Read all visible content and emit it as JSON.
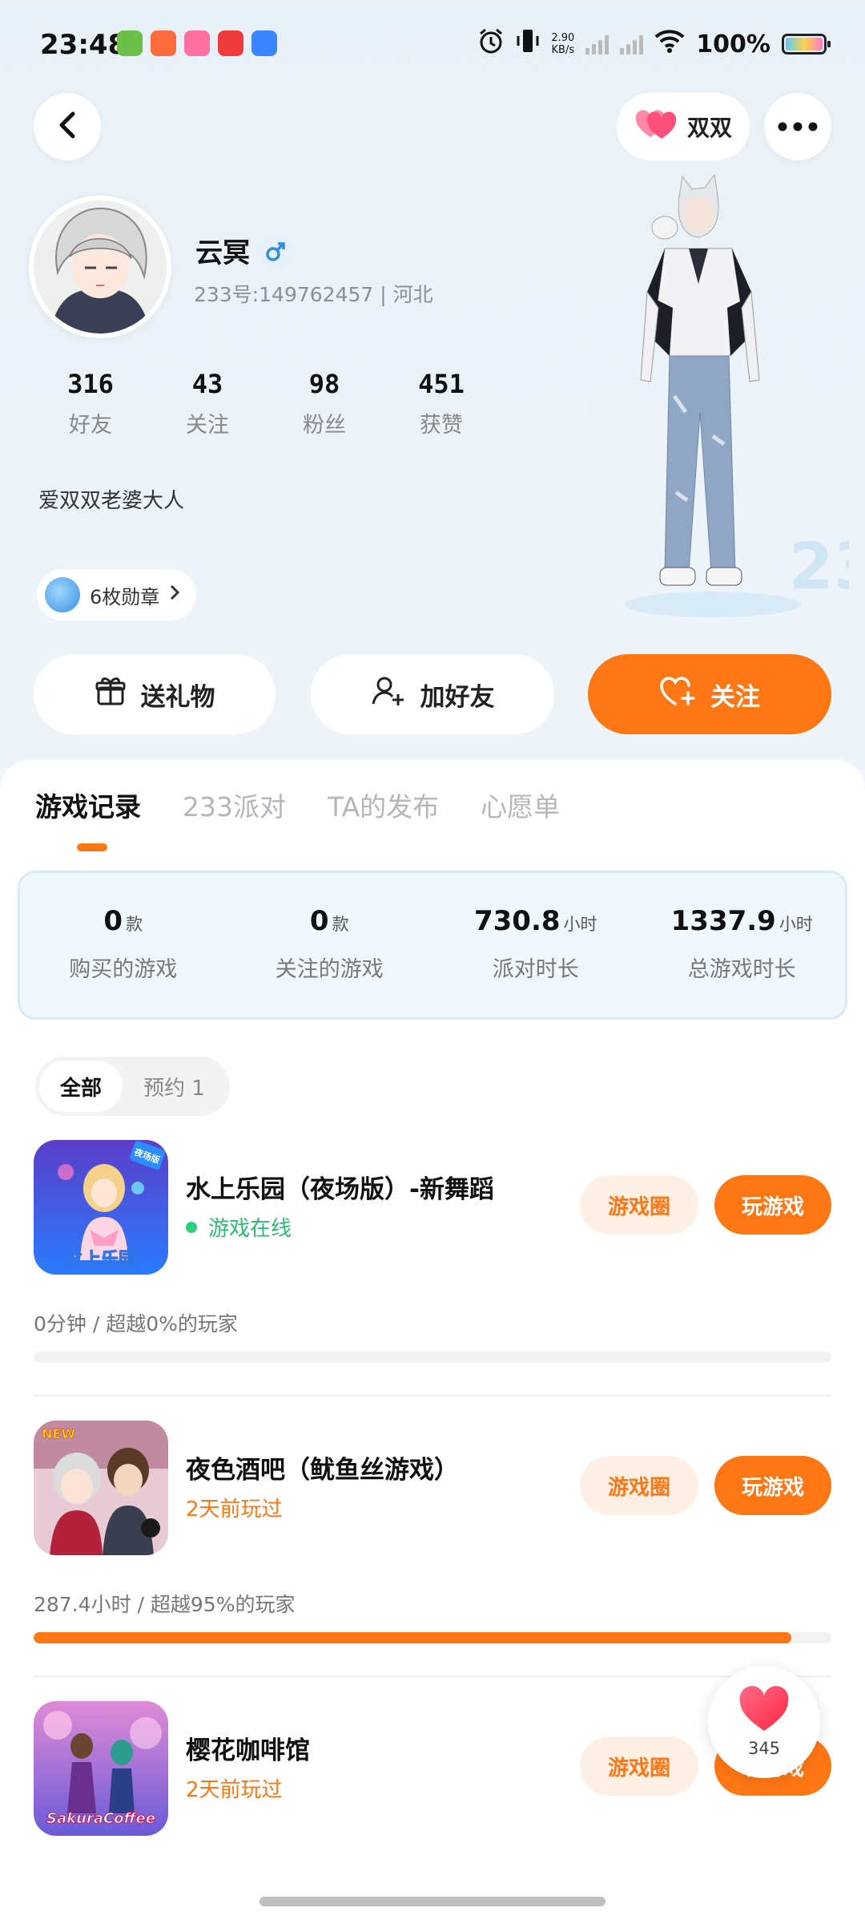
{
  "status_bar": {
    "time": "23:48",
    "speed_top": "2.90",
    "speed_unit": "KB/s",
    "battery": "100%"
  },
  "top_nav": {
    "couple_label": "双双"
  },
  "profile": {
    "name": "云冥",
    "uid_line": "233号:149762457 | 河北",
    "stats": [
      {
        "num": "316",
        "label": "好友"
      },
      {
        "num": "43",
        "label": "关注"
      },
      {
        "num": "98",
        "label": "粉丝"
      },
      {
        "num": "451",
        "label": "获赞"
      }
    ],
    "bio": "爱双双老婆大人",
    "medal_label": "6枚勋章"
  },
  "actions": {
    "gift": "送礼物",
    "add_friend": "加好友",
    "follow": "关注"
  },
  "tabs": [
    "游戏记录",
    "233派对",
    "TA的发布",
    "心愿单"
  ],
  "summary": [
    {
      "value": "0",
      "unit": "款",
      "label": "购买的游戏"
    },
    {
      "value": "0",
      "unit": "款",
      "label": "关注的游戏"
    },
    {
      "value": "730.8",
      "unit": "小时",
      "label": "派对时长"
    },
    {
      "value": "1337.9",
      "unit": "小时",
      "label": "总游戏时长"
    }
  ],
  "filter": {
    "all": "全部",
    "reserved": "预约 1"
  },
  "games": [
    {
      "title": "水上乐园（夜场版）-新舞蹈",
      "status": "游戏在线",
      "online": true,
      "time_line": "0分钟 / 超越0%的玩家",
      "progress": 0,
      "circle_btn": "游戏圈",
      "play_btn": "玩游戏",
      "icon_text": "水上乐园",
      "badge": "夜场版"
    },
    {
      "title": "夜色酒吧（鱿鱼丝游戏）",
      "status": "2天前玩过",
      "online": false,
      "time_line": "287.4小时 / 超越95%的玩家",
      "progress": 0.95,
      "circle_btn": "游戏圈",
      "play_btn": "玩游戏",
      "icon_text": "",
      "badge": "NEW"
    },
    {
      "title": "樱花咖啡馆",
      "status": "2天前玩过",
      "online": false,
      "time_line": "",
      "progress": 0,
      "circle_btn": "游戏圈",
      "play_btn": "玩游戏",
      "icon_text": "SakuraCoffee",
      "badge": ""
    }
  ],
  "like_float": {
    "count": "345"
  },
  "colors": {
    "accent": "#ff7714",
    "online": "#2bbb73"
  }
}
